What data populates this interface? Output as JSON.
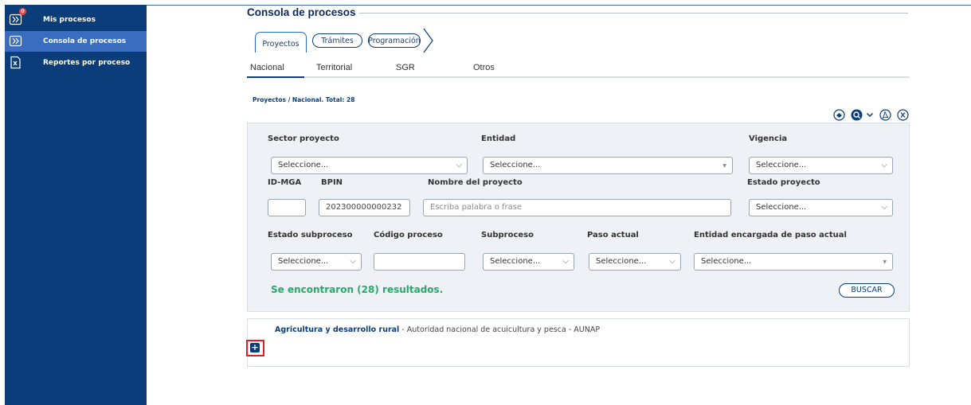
{
  "sidebar": {
    "items": [
      {
        "label": "Mis procesos",
        "icon": "processes-icon",
        "badge": "0"
      },
      {
        "label": "Consola de procesos",
        "icon": "console-icon",
        "active": true
      },
      {
        "label": "Reportes por proceso",
        "icon": "excel-report-icon"
      }
    ]
  },
  "header": {
    "title": "Consola de procesos"
  },
  "top_tabs": [
    "Proyectos",
    "Trámites",
    "Programación"
  ],
  "sub_tabs": [
    "Nacional",
    "Territorial",
    "SGR",
    "Otros"
  ],
  "path": "Proyectos / Nacional. Total: 28",
  "toolbar": {
    "icons": [
      "column-chooser-icon",
      "search-filter-icon",
      "chevron-down-icon",
      "pdf-export-icon",
      "excel-export-icon"
    ]
  },
  "filters": {
    "sector_label": "Sector proyecto",
    "sector_value": "Seleccione...",
    "entidad_label": "Entidad",
    "entidad_value": "Seleccione...",
    "vigencia_label": "Vigencia",
    "vigencia_value": "Seleccione...",
    "idmga_label": "ID-MGA",
    "idmga_value": "",
    "bpin_label": "BPIN",
    "bpin_value": "202300000000232",
    "nombre_label": "Nombre del proyecto",
    "nombre_placeholder": "Escriba palabra o frase",
    "estado_proyecto_label": "Estado proyecto",
    "estado_proyecto_value": "Seleccione...",
    "estado_subproceso_label": "Estado subproceso",
    "estado_subproceso_value": "Seleccione...",
    "codigo_proceso_label": "Código proceso",
    "codigo_proceso_value": "",
    "subproceso_label": "Subproceso",
    "subproceso_value": "Seleccione...",
    "paso_actual_label": "Paso actual",
    "paso_actual_value": "Seleccione...",
    "entidad_paso_label": "Entidad encargada de paso actual",
    "entidad_paso_value": "Seleccione..."
  },
  "results": {
    "summary": "Se encontraron (28) resultados.",
    "search_button": "BUSCAR",
    "group_sector": "Agricultura y desarrollo rural",
    "group_entity": " - Autoridad nacional de acuicultura y pesca - AUNAP",
    "expand_symbol": "+"
  },
  "colors": {
    "sidebar": "#0a3d7a",
    "sidebar_active": "#3a6cc0",
    "result_green": "#2aa86a",
    "highlight_red": "#e02020"
  }
}
